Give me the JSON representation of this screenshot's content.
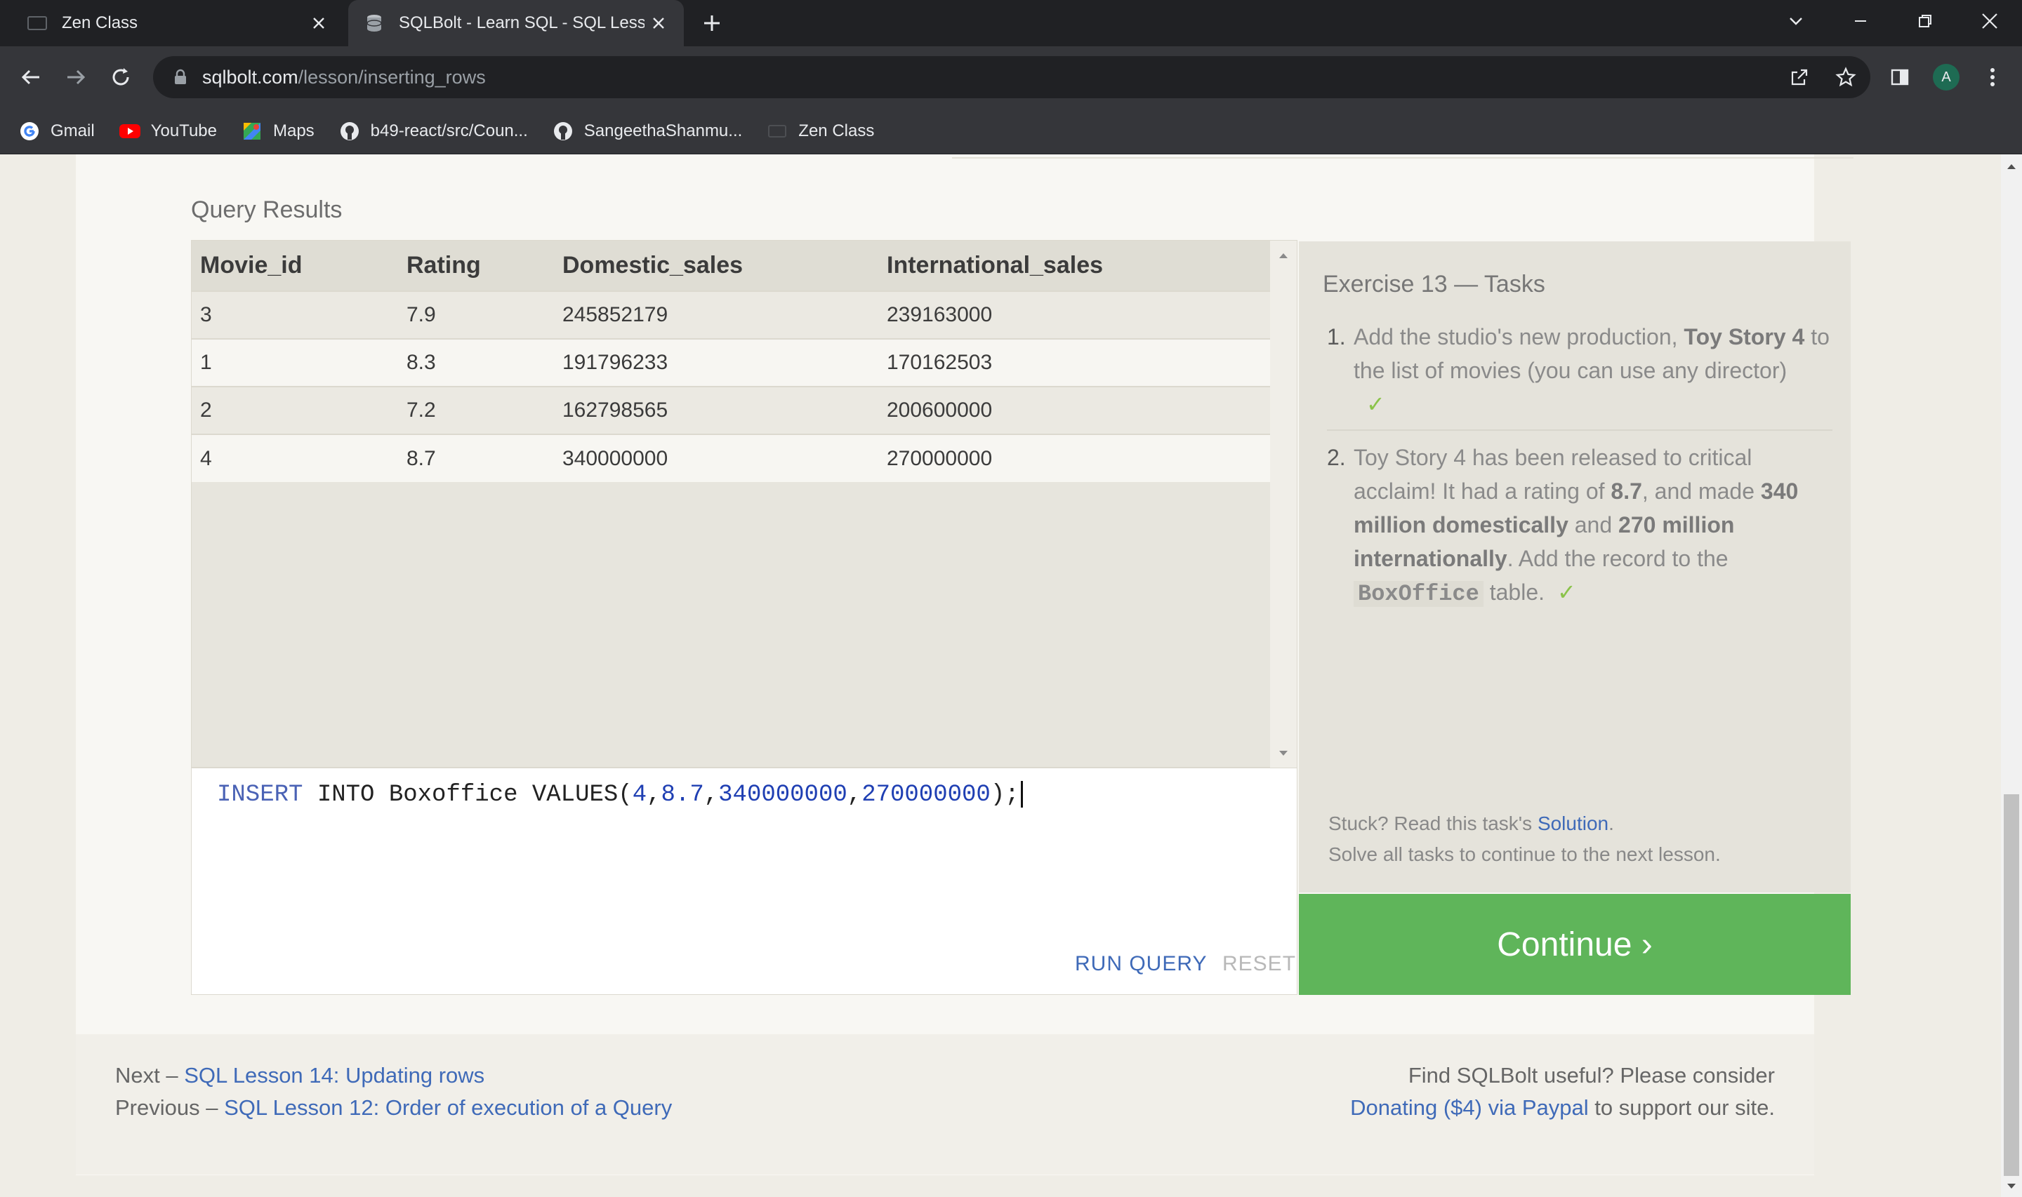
{
  "browser": {
    "tabs": [
      {
        "title": "Zen Class"
      },
      {
        "title": "SQLBolt - Learn SQL - SQL Lesson"
      }
    ],
    "url_host": "sqlbolt.com",
    "url_path": "/lesson/inserting_rows",
    "profile_initial": "A",
    "bookmarks": [
      {
        "label": "Gmail",
        "icon": "google-icon"
      },
      {
        "label": "YouTube",
        "icon": "youtube-icon"
      },
      {
        "label": "Maps",
        "icon": "maps-icon"
      },
      {
        "label": "b49-react/src/Coun...",
        "icon": "github-icon"
      },
      {
        "label": "SangeethaShanmu...",
        "icon": "github-icon"
      },
      {
        "label": "Zen Class",
        "icon": "zen-icon"
      }
    ]
  },
  "results": {
    "label": "Query Results",
    "columns": [
      "Movie_id",
      "Rating",
      "Domestic_sales",
      "International_sales"
    ],
    "rows": [
      [
        "3",
        "7.9",
        "245852179",
        "239163000"
      ],
      [
        "1",
        "8.3",
        "191796233",
        "170162503"
      ],
      [
        "2",
        "7.2",
        "162798565",
        "200600000"
      ],
      [
        "4",
        "8.7",
        "340000000",
        "270000000"
      ]
    ]
  },
  "editor": {
    "kw": "INSERT",
    "mid": " INTO Boxoffice VALUES(",
    "n1": "4",
    "n2": "8.7",
    "n3": "340000000",
    "n4": "270000000",
    "tail": ");",
    "run_label": "RUN QUERY",
    "reset_label": "RESET"
  },
  "tasks": {
    "title": "Exercise 13 — Tasks",
    "t1": {
      "num": "1.",
      "a": "Add the studio's new production, ",
      "b": "Toy Story 4",
      "c": " to the list of movies (you can use any director)",
      "check": "✓"
    },
    "t2": {
      "num": "2.",
      "a": "Toy Story 4 has been released to critical acclaim! It had a rating of ",
      "b": "8.7",
      "c": ", and made ",
      "d": "340 million domestically",
      "e": " and ",
      "f": "270 million internationally",
      "g": ". Add the record to the ",
      "h": "BoxOffice",
      "i": " table.",
      "check": "✓"
    },
    "stuck_prefix": "Stuck? Read this task's ",
    "stuck_link": "Solution",
    "stuck_suffix": ".",
    "solve_all": "Solve all tasks to continue to the next lesson.",
    "continue_label": "Continue ›"
  },
  "footer": {
    "next_prefix": "Next – ",
    "next_link": "SQL Lesson 14: Updating rows",
    "prev_prefix": "Previous – ",
    "prev_link": "SQL Lesson 12: Order of execution of a Query",
    "useful": "Find SQLBolt useful? Please consider",
    "donate_link": "Donating ($4) via Paypal",
    "donate_suffix": " to support our site."
  },
  "colors": {
    "accent_link": "#3f6ab8",
    "continue_green": "#5fb55a",
    "check_green": "#8bc34a"
  }
}
